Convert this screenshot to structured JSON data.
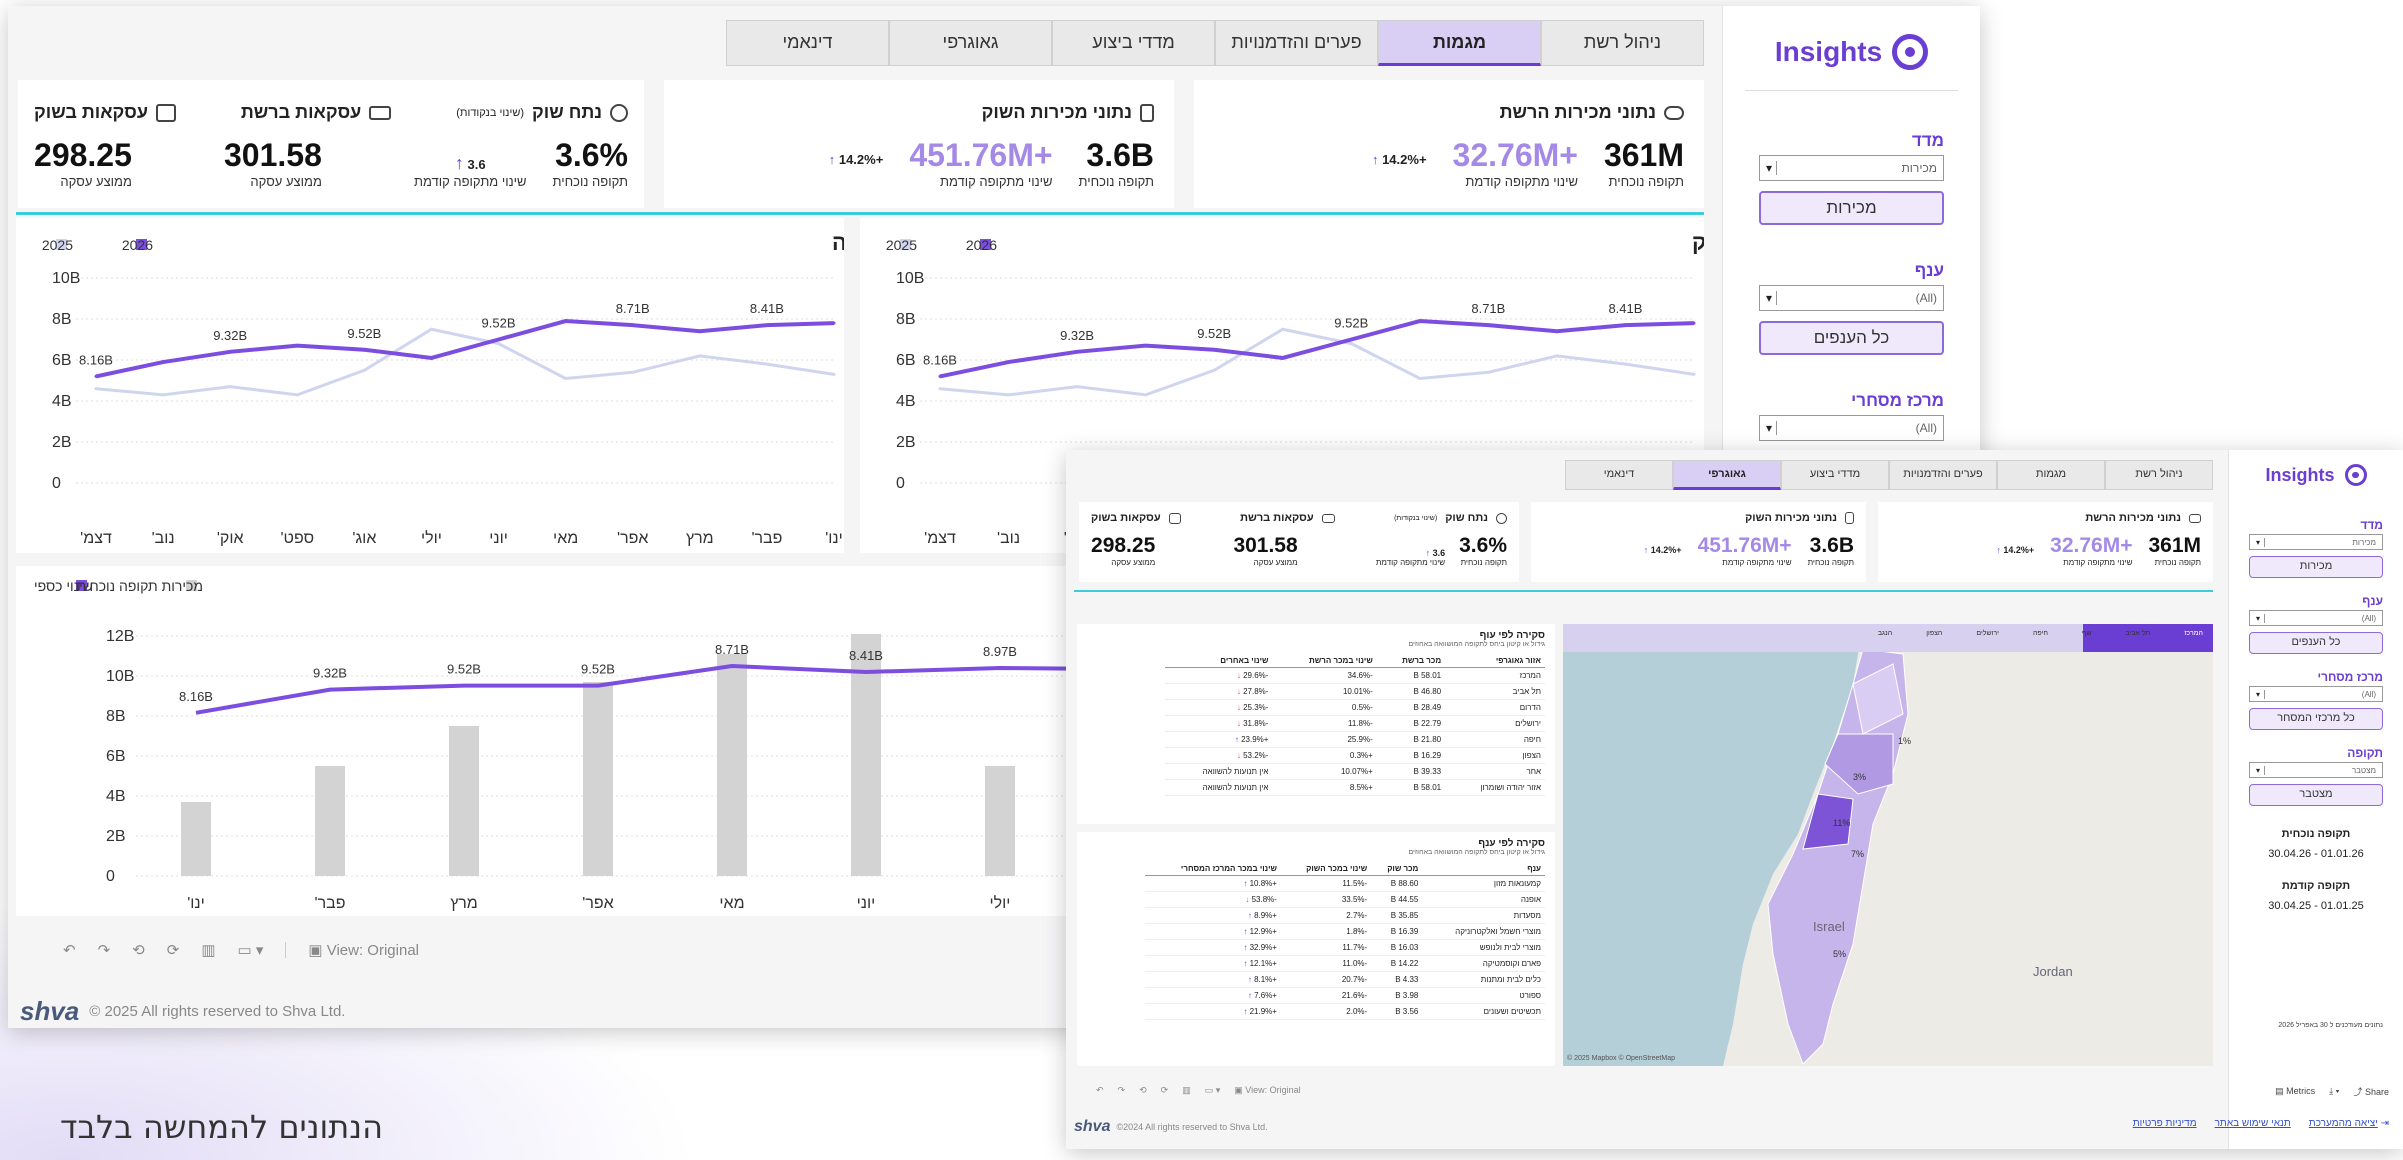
{
  "caption": "הנתונים להמחשה בלבד",
  "brand": "Insights",
  "colors": {
    "accent": "#6a3ed2",
    "series_current": "#7b4ee0",
    "series_prev": "#cfd5ee",
    "bars": "#d3d3d3",
    "divider": "#3ecbdc"
  },
  "tabs1": [
    "ניהול רשת",
    "מגמות",
    "פערים והזדמנויות",
    "מדדי ביצוע",
    "גאוגרפי",
    "דינאמי"
  ],
  "tabs2": [
    "ניהול רשת",
    "מגמות",
    "פערים והזדמנויות",
    "מדדי ביצוע",
    "גאוגרפי",
    "דינאמי"
  ],
  "filters": {
    "metric_label": "מדד",
    "metric_value": "מכירות",
    "metric_btn": "מכירות",
    "branch_label": "ענף",
    "branch_value": "(All)",
    "branch_btn": "כל הענפים",
    "center_label": "מרכז מסחרי",
    "center_value": "(All)",
    "center_btn": "כל מרכזי המסחר",
    "period_label": "תקופה",
    "period_value": "מצטבר",
    "period_btn": "מצטבר",
    "cur_label": "תקופה נוכחית",
    "cur_value": "01.01.26 - 30.04.26",
    "prev_label": "תקופה קודמת",
    "prev_value": "01.01.25 - 30.04.25",
    "note": "נתונים מעודכנים ל 30 באפריל 2026"
  },
  "kpi": {
    "net_title": "נתוני מכירות הרשת",
    "net_value": "361M",
    "net_value_lbl": "תקופה נוכחית",
    "net_change": "+32.76M",
    "net_change_lbl": "שינוי מתקופה קודמת",
    "net_pct": "+14.2%",
    "mkt_title": "נתוני מכירות השוק",
    "mkt_value": "3.6B",
    "mkt_value_lbl": "תקופה נוכחית",
    "mkt_change": "+451.76M",
    "mkt_change_lbl": "שינוי מתקופה קודמת",
    "mkt_pct": "+14.2%",
    "share_title": "נתח שוק",
    "share_sub": "(שינוי בנקודות)",
    "share_value": "3.6%",
    "share_value_lbl": "תקופה נוכחית",
    "share_change": "3.6",
    "share_change_lbl": "שינוי מתקופה קודמת",
    "deals_title": "עסקאות ברשת",
    "deals_value": "301.58",
    "deals_lbl": "ממוצע עסקה",
    "mdeals_title": "עסקאות בשוק",
    "mdeals_value": "298.25",
    "mdeals_lbl": "ממוצע עסקה"
  },
  "chart_data": [
    {
      "type": "line",
      "title": "נתח שוק",
      "legend": [
        "2026",
        "2025"
      ],
      "yticks": [
        "0",
        "2B",
        "4B",
        "6B",
        "8B",
        "10B"
      ],
      "categories": [
        "ינו'",
        "פבר'",
        "מרץ",
        "אפר'",
        "מאי",
        "יוני",
        "יולי",
        "אוג'",
        "ספט'",
        "אוק'",
        "נוב'",
        "דצמ'"
      ],
      "series": [
        {
          "name": "2026",
          "values": [
            5.2,
            5.9,
            6.4,
            6.7,
            6.5,
            6.1,
            7.0,
            7.9,
            7.7,
            7.4,
            7.7,
            7.8
          ]
        },
        {
          "name": "2025",
          "values": [
            4.6,
            4.3,
            4.7,
            4.3,
            5.5,
            7.5,
            6.8,
            5.1,
            5.4,
            6.2,
            5.8,
            5.3
          ]
        }
      ],
      "labels": [
        "8.16B",
        "9.32B",
        "9.52B",
        "9.52B",
        "8.71B",
        "8.41B"
      ]
    },
    {
      "type": "line",
      "title": "מכירות שוק זירת השוואה",
      "legend": [
        "2026",
        "2025"
      ],
      "yticks": [
        "0",
        "2B",
        "4B",
        "6B",
        "8B",
        "10B"
      ],
      "categories": [
        "ינו'",
        "פבר'",
        "מרץ",
        "אפר'",
        "מאי",
        "יוני",
        "יולי",
        "אוג'",
        "ספט'",
        "אוק'",
        "נוב'",
        "דצמ'"
      ],
      "series": [
        {
          "name": "2026",
          "values": [
            5.2,
            5.9,
            6.4,
            6.7,
            6.5,
            6.1,
            7.0,
            7.9,
            7.7,
            7.4,
            7.7,
            7.8
          ]
        },
        {
          "name": "2025",
          "values": [
            4.6,
            4.3,
            4.7,
            4.3,
            5.5,
            7.5,
            6.8,
            5.1,
            5.4,
            6.2,
            5.8,
            5.3
          ]
        }
      ],
      "labels": [
        "8.16B",
        "9.32B",
        "9.52B",
        "9.52B",
        "8.71B",
        "8.41B"
      ]
    },
    {
      "type": "bar",
      "legend": [
        "שינוי כספי",
        "מכירות תקופה נוכחית"
      ],
      "yticks": [
        "0",
        "2B",
        "4B",
        "6B",
        "8B",
        "10B",
        "12B"
      ],
      "categories": [
        "ינו'",
        "פבר'",
        "מרץ",
        "אפר'",
        "מאי",
        "יוני",
        "יולי"
      ],
      "bars": [
        3.7,
        5.5,
        7.5,
        9.7,
        11.1,
        12.1,
        5.5
      ],
      "line": [
        8.16,
        9.32,
        9.52,
        9.52,
        10.5,
        10.2,
        10.4
      ],
      "labels": [
        "8.16B",
        "9.32B",
        "9.52B",
        "9.52B",
        "8.71B",
        "8.41B",
        "8.97B"
      ]
    }
  ],
  "table1": {
    "title": "סקירה לפי עוף",
    "sub": "גידול או קיטון ביחס לתקופה המושוואה באחוזים",
    "headers": [
      "אזור גאוגרפי",
      "מכר ברשת",
      "שינוי במכר הרשת",
      "שינוי באחרים"
    ],
    "rows": [
      [
        "המרכז",
        "58.01 B",
        "-34.6%",
        "-29.6%"
      ],
      [
        "תל אביב",
        "46.80 B",
        "-10.01%",
        "-27.8%"
      ],
      [
        "הדרום",
        "28.49 B",
        "-0.5%",
        "-25.3%"
      ],
      [
        "ירושלים",
        "22.79 B",
        "-11.8%",
        "-31.8%"
      ],
      [
        "חיפה",
        "21.80 B",
        "-25.9%",
        "+23.9%"
      ],
      [
        "הצפון",
        "16.29 B",
        "+0.3%",
        "-53.2%"
      ],
      [
        "אחר",
        "39.33 B",
        "+10.07%",
        "אין תנועות להשוואה"
      ],
      [
        "אזור יהודה ושומרון",
        "58.01 B",
        "+8.5%",
        "אין תנועות להשוואה"
      ]
    ]
  },
  "table2": {
    "title": "סקירה לפי ענף",
    "sub": "גידול או קיטון ביחס לתקופה המושוואה באחוזים",
    "headers": [
      "ענף",
      "מכר שוק",
      "שינוי במכר השוק",
      "שינוי במכר המרכז המסחרי"
    ],
    "rows": [
      [
        "קמעונאות מזון",
        "88.60 B",
        "-11.5%",
        "+10.8%"
      ],
      [
        "אופנה",
        "44.55 B",
        "-33.5%",
        "-53.8%"
      ],
      [
        "מסעדות",
        "35.85 B",
        "-2.7%",
        "+8.9%"
      ],
      [
        "מוצרי חשמל ואלקטרוניקה",
        "16.39 B",
        "-1.8%",
        "+12.9%"
      ],
      [
        "מוצרי לבית ולנופש",
        "16.03 B",
        "-11.7%",
        "+32.9%"
      ],
      [
        "פארם וקוסמטיקה",
        "14.22 B",
        "-11.0%",
        "+12.1%"
      ],
      [
        "כלים לבית ומתנות",
        "4.33 B",
        "-20.7%",
        "+8.1%"
      ],
      [
        "ספורט",
        "3.98 B",
        "-21.6%",
        "+7.6%"
      ],
      [
        "תכשיטים ושעונים",
        "3.56 B",
        "-2.0%",
        "+21.9%"
      ]
    ]
  },
  "map": {
    "labels": [
      "Israel",
      "Jordan",
      "1%",
      "3%",
      "11%",
      "7%",
      "5%"
    ],
    "tabs": [
      "המרכז",
      "תל אביב",
      "שף",
      "חיפה",
      "ירושלים",
      "הצפון",
      "הנגב"
    ],
    "credit": "© 2025 Mapbox © OpenStreetMap"
  },
  "toolbar": {
    "view": "View: Original",
    "metrics": "Metrics",
    "share": "Share"
  },
  "footer1": "© 2025 All rights reserved to Shva Ltd.",
  "footer2": "©2024 All rights reserved to Shva Ltd.",
  "logo_text": "shva",
  "links": {
    "logout": "יציאה מהמערכת",
    "terms": "תנאי שימוש באתר",
    "privacy": "מדיניות פרטיות"
  }
}
